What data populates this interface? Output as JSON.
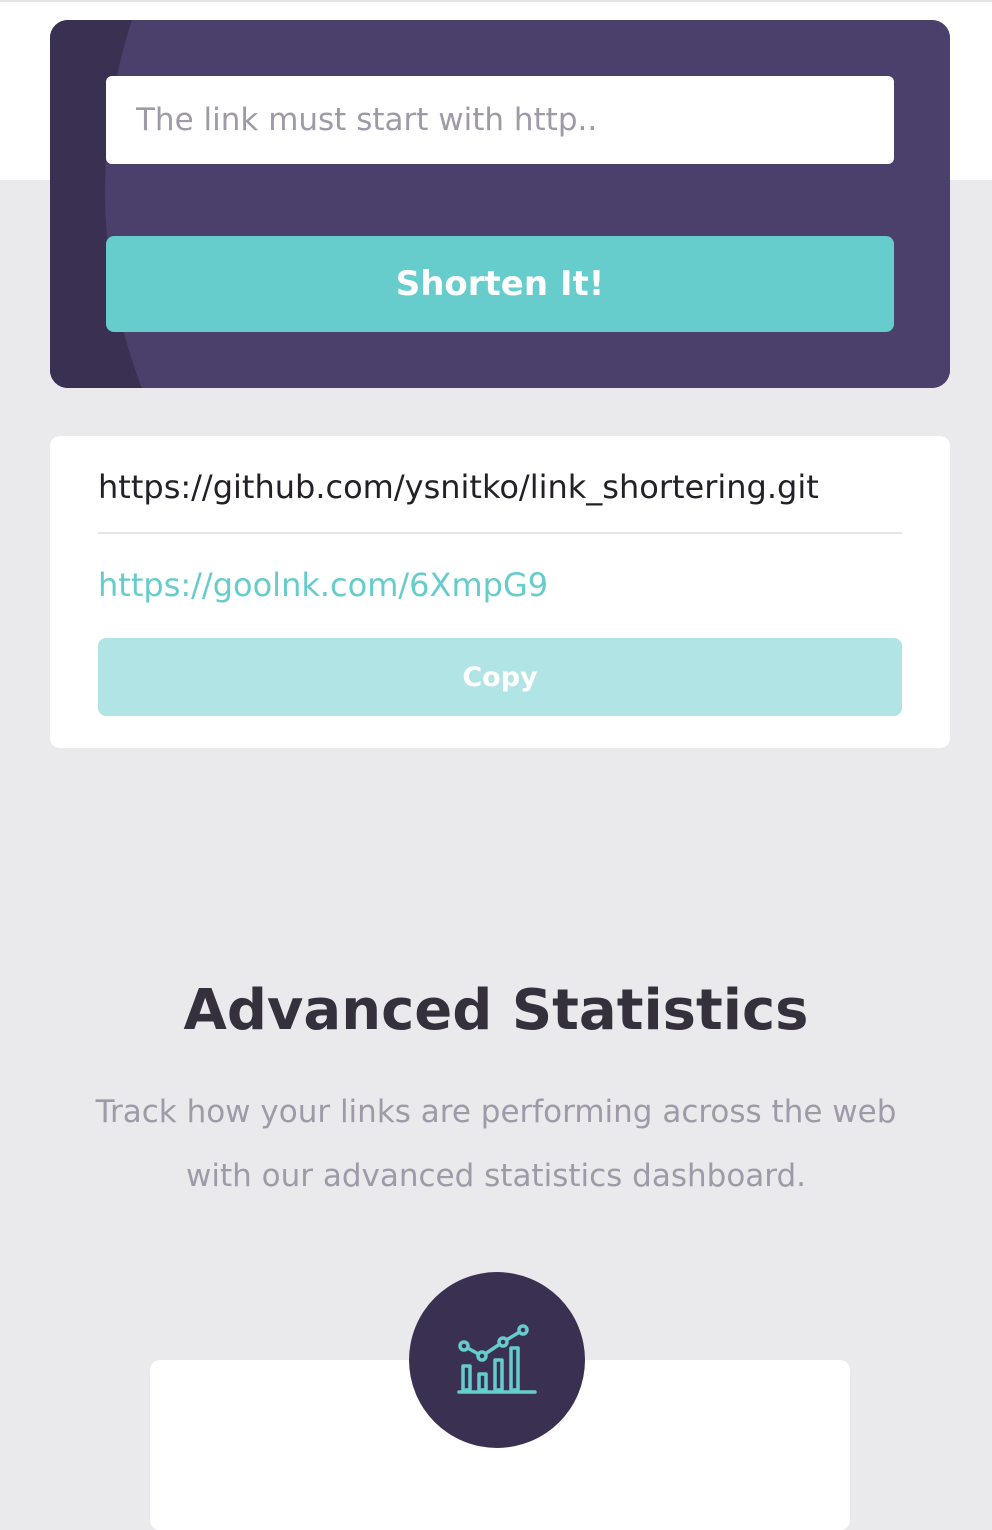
{
  "shorten_form": {
    "input_placeholder": "The link must start with http..",
    "input_value": "",
    "button_label": "Shorten It!"
  },
  "result": {
    "original_url": "https://github.com/ysnitko/link_shortering.git",
    "short_url": "https://goolnk.com/6XmpG9",
    "copy_label": "Copy"
  },
  "statistics": {
    "title": "Advanced Statistics",
    "description": "Track how your links are performing across the web with our advanced statistics dashboard."
  },
  "feature_card": {
    "icon": "bar-chart-icon"
  },
  "colors": {
    "panel": "#4b3f6b",
    "panel_dark": "#3a3152",
    "accent": "#66cccc",
    "accent_light": "#b1e4e4",
    "background": "#eaeaed",
    "heading": "#34313d",
    "muted_text": "#9e9aa7"
  }
}
